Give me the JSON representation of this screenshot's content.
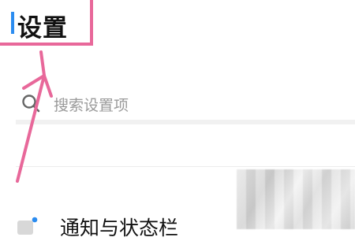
{
  "header": {
    "title": "设置"
  },
  "search": {
    "placeholder": "搜索设置项"
  },
  "items": [
    {
      "label": "通知与状态栏"
    }
  ],
  "icons": {
    "search": "search-icon",
    "notification": "notification-icon"
  },
  "colors": {
    "accent": "#2b8cf0",
    "highlight": "#e8689a",
    "placeholder": "#9a9a9a"
  }
}
